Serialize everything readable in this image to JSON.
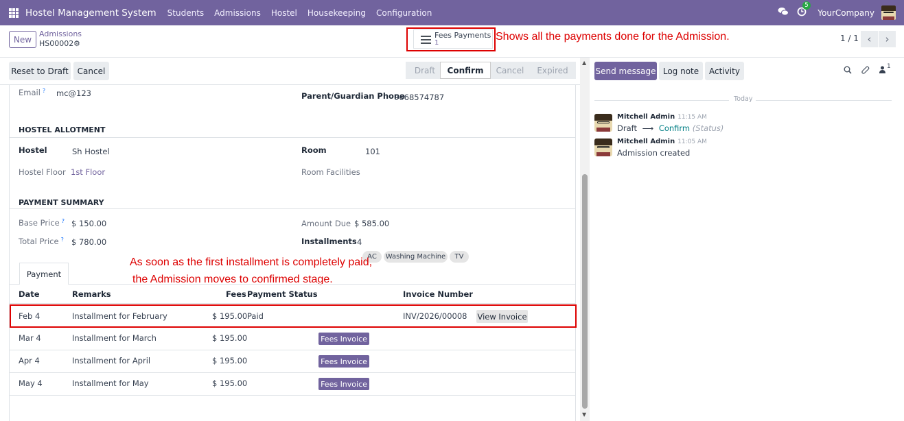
{
  "navbar": {
    "brand": "Hostel Management System",
    "menu": [
      "Students",
      "Admissions",
      "Hostel",
      "Housekeeping",
      "Configuration"
    ],
    "activity_badge": "5",
    "company": "YourCompany"
  },
  "control": {
    "new_label": "New",
    "breadcrumb": "Admissions",
    "record_name": "HS00002",
    "smart_button": {
      "label": "Fees Payments",
      "count": "1"
    },
    "pager": "1 / 1"
  },
  "annotations": {
    "top": "Shows all the payments done for the Admission.",
    "line1": "As soon as the first installment is completely paid,",
    "line2": "the Admission moves to confirmed stage."
  },
  "statusbar": {
    "reset_label": "Reset to Draft",
    "cancel_label": "Cancel",
    "stages": [
      "Draft",
      "Confirm",
      "Cancel",
      "Expired"
    ],
    "active_stage": "Confirm"
  },
  "form": {
    "email_label": "Email",
    "email_value": "mc@123",
    "guardian_phone_label": "Parent/Guardian Phone",
    "guardian_phone_value": "9068574787",
    "hostel_section": "HOSTEL ALLOTMENT",
    "hostel_label": "Hostel",
    "hostel_value": "Sh Hostel",
    "room_label": "Room",
    "room_value": "101",
    "floor_label": "Hostel Floor",
    "floor_value": "1st Floor",
    "facilities_label": "Room Facilities",
    "facilities": [
      "AC",
      "Washing Machine",
      "TV"
    ],
    "payment_section": "PAYMENT SUMMARY",
    "base_price_label": "Base Price",
    "base_price_value": "$ 150.00",
    "amount_due_label": "Amount Due",
    "amount_due_value": "$ 585.00",
    "total_price_label": "Total Price",
    "total_price_value": "$ 780.00",
    "installments_label": "Installments",
    "installments_value": "4",
    "help_mark": "?"
  },
  "tab": {
    "label": "Payment"
  },
  "table": {
    "headers": {
      "date": "Date",
      "remarks": "Remarks",
      "fees": "Fees",
      "status": "Payment Status",
      "invoice": "Invoice Number"
    },
    "rows": [
      {
        "date": "Feb 4",
        "remarks": "Installment for February",
        "fees": "$ 195.00",
        "status": "Paid",
        "invoice": "INV/2026/00008",
        "action": "View Invoice"
      },
      {
        "date": "Mar 4",
        "remarks": "Installment for March",
        "fees": "$ 195.00",
        "status": "",
        "invoice": "",
        "action": "Fees Invoice"
      },
      {
        "date": "Apr 4",
        "remarks": "Installment for April",
        "fees": "$ 195.00",
        "status": "",
        "invoice": "",
        "action": "Fees Invoice"
      },
      {
        "date": "May 4",
        "remarks": "Installment for May",
        "fees": "$ 195.00",
        "status": "",
        "invoice": "",
        "action": "Fees Invoice"
      }
    ]
  },
  "chatter": {
    "send_message": "Send message",
    "log_note": "Log note",
    "activity": "Activity",
    "followers_count": "1",
    "today": "Today",
    "messages": [
      {
        "author": "Mitchell Admin",
        "time": "11:15 AM",
        "from_stage": "Draft",
        "to_stage": "Confirm",
        "field": "(Status)"
      },
      {
        "author": "Mitchell Admin",
        "time": "11:05 AM",
        "body": "Admission created"
      }
    ]
  }
}
